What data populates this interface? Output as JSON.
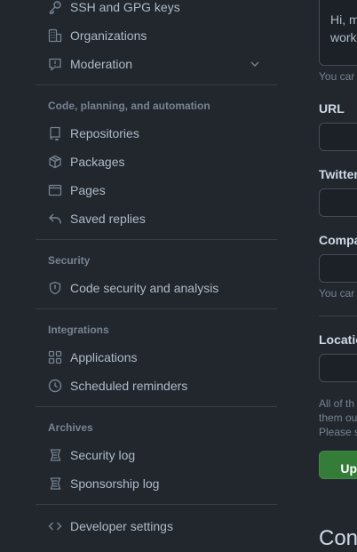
{
  "sidebar": {
    "top_items": [
      {
        "label": "SSH and GPG keys",
        "icon": "key-icon"
      },
      {
        "label": "Organizations",
        "icon": "organization-icon"
      },
      {
        "label": "Moderation",
        "icon": "report-icon"
      }
    ],
    "sections": [
      {
        "heading": "Code, planning, and automation",
        "items": [
          {
            "label": "Repositories",
            "icon": "repo-icon"
          },
          {
            "label": "Packages",
            "icon": "package-icon"
          },
          {
            "label": "Pages",
            "icon": "browser-icon"
          },
          {
            "label": "Saved replies",
            "icon": "reply-icon"
          }
        ]
      },
      {
        "heading": "Security",
        "items": [
          {
            "label": "Code security and analysis",
            "icon": "shield-lock-icon"
          }
        ]
      },
      {
        "heading": "Integrations",
        "items": [
          {
            "label": "Applications",
            "icon": "apps-icon"
          },
          {
            "label": "Scheduled reminders",
            "icon": "clock-icon"
          }
        ]
      },
      {
        "heading": "Archives",
        "items": [
          {
            "label": "Security log",
            "icon": "log-icon"
          },
          {
            "label": "Sponsorship log",
            "icon": "log-icon"
          }
        ]
      }
    ],
    "developer_settings": {
      "label": "Developer settings",
      "icon": "code-icon"
    }
  },
  "form": {
    "bio_text_line1": "Hi, m",
    "bio_text_line2": "work",
    "bio_note": "You car",
    "url_label": "URL",
    "twitter_label": "Twitter",
    "company_label": "Compa",
    "company_note": "You car",
    "location_label": "Locatio",
    "footer_line1": "All of th",
    "footer_line2": "them ou",
    "footer_line3": "Please s",
    "update_button": "Upd",
    "next_heading": "Con"
  },
  "colors": {
    "background": "#22272e",
    "text": "#adbac7",
    "muted": "#768390",
    "border": "#444c56",
    "button_green": "#347d39"
  }
}
